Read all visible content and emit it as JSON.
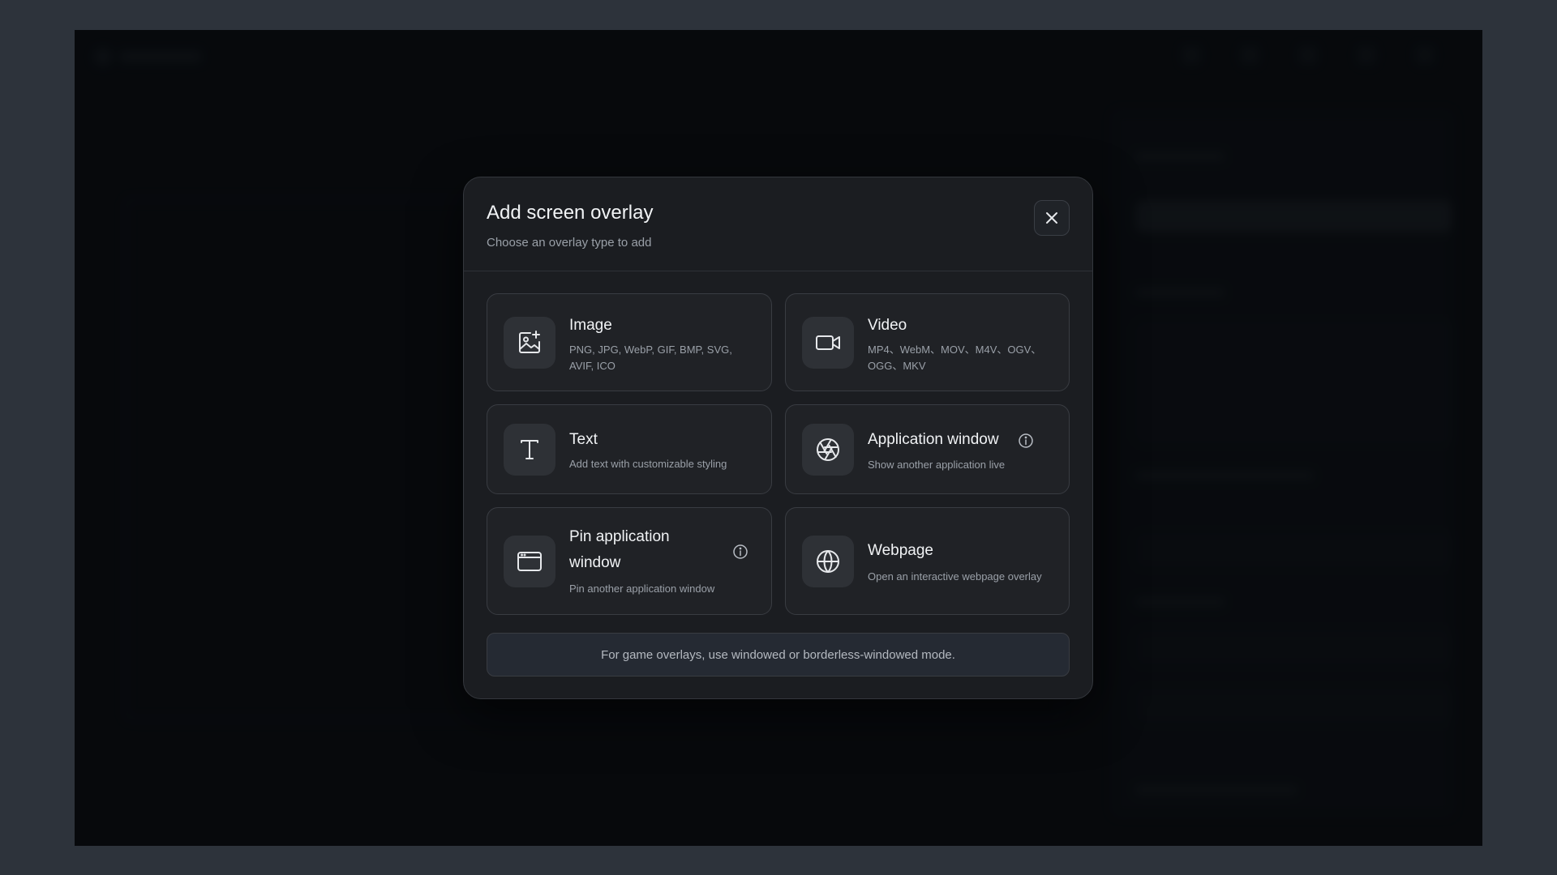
{
  "modal": {
    "title": "Add screen overlay",
    "subtitle": "Choose an overlay type to add",
    "close_icon": "close-icon"
  },
  "options": [
    {
      "icon": "image-add-icon",
      "title": "Image",
      "description": "PNG, JPG, WebP, GIF, BMP, SVG, AVIF, ICO"
    },
    {
      "icon": "video-camera-icon",
      "title": "Video",
      "description": "MP4、WebM、MOV、M4V、OGV、OGG、MKV"
    },
    {
      "icon": "text-icon",
      "title": "Text",
      "description": "Add text with customizable styling"
    },
    {
      "icon": "aperture-icon",
      "title": "Application window",
      "description": "Show another application live",
      "info_icon": "info-icon"
    },
    {
      "icon": "browser-window-icon",
      "title": "Pin application window",
      "description": "Pin another application window",
      "info_icon": "info-icon"
    },
    {
      "icon": "globe-icon",
      "title": "Webpage",
      "description": "Open an interactive webpage overlay"
    }
  ],
  "note": "For game overlays, use windowed or borderless-windowed mode.",
  "colors": {
    "page_background": "#2d333b",
    "modal_background": "#1b1d21",
    "card_background": "#202226",
    "note_background": "#252a33",
    "text_primary": "#f1f3f5",
    "text_secondary": "#9aa0a8"
  }
}
